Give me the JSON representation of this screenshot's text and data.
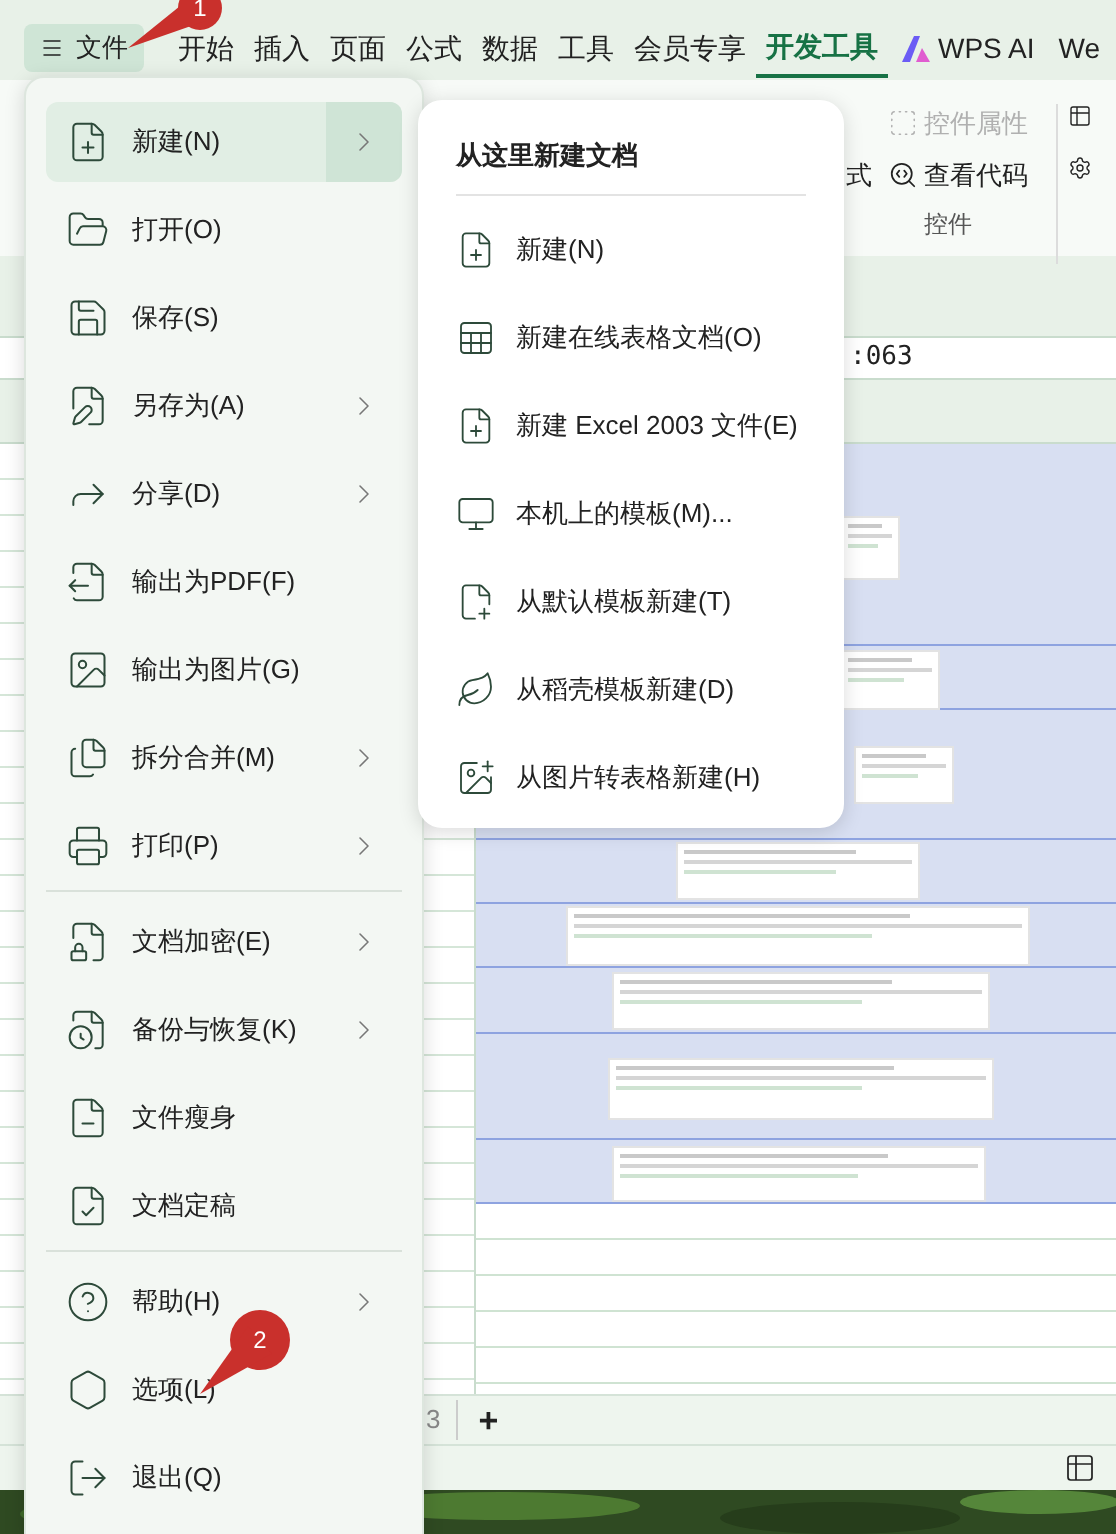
{
  "tabs": [
    {
      "label": "文件",
      "selected": false,
      "kind": "file"
    },
    {
      "label": "开始",
      "selected": false,
      "kind": "plain"
    },
    {
      "label": "插入",
      "selected": false,
      "kind": "plain"
    },
    {
      "label": "页面",
      "selected": false,
      "kind": "plain"
    },
    {
      "label": "公式",
      "selected": false,
      "kind": "plain"
    },
    {
      "label": "数据",
      "selected": false,
      "kind": "plain"
    },
    {
      "label": "工具",
      "selected": false,
      "kind": "plain"
    },
    {
      "label": "会员专享",
      "selected": false,
      "kind": "plain"
    },
    {
      "label": "开发工具",
      "selected": true,
      "kind": "plain"
    },
    {
      "label": "WPS AI",
      "selected": false,
      "kind": "ai"
    },
    {
      "label": "We",
      "selected": false,
      "kind": "plain"
    }
  ],
  "ribbon": {
    "cut_label": "式",
    "buttons": [
      {
        "label": "控件属性",
        "disabled": true
      },
      {
        "label": "查看代码",
        "disabled": false
      }
    ],
    "group_label": "控件"
  },
  "formula_bar": {
    "value": ":063"
  },
  "file_menu": {
    "groups": [
      [
        {
          "label": "新建(N)",
          "has_submenu": true,
          "selected": true
        },
        {
          "label": "打开(O)",
          "has_submenu": false,
          "selected": false
        },
        {
          "label": "保存(S)",
          "has_submenu": false,
          "selected": false
        },
        {
          "label": "另存为(A)",
          "has_submenu": true,
          "selected": false
        },
        {
          "label": "分享(D)",
          "has_submenu": true,
          "selected": false
        },
        {
          "label": "输出为PDF(F)",
          "has_submenu": false,
          "selected": false
        },
        {
          "label": "输出为图片(G)",
          "has_submenu": false,
          "selected": false
        },
        {
          "label": "拆分合并(M)",
          "has_submenu": true,
          "selected": false
        },
        {
          "label": "打印(P)",
          "has_submenu": true,
          "selected": false
        }
      ],
      [
        {
          "label": "文档加密(E)",
          "has_submenu": true,
          "selected": false
        },
        {
          "label": "备份与恢复(K)",
          "has_submenu": true,
          "selected": false
        },
        {
          "label": "文件瘦身",
          "has_submenu": false,
          "selected": false
        },
        {
          "label": "文档定稿",
          "has_submenu": false,
          "selected": false
        }
      ],
      [
        {
          "label": "帮助(H)",
          "has_submenu": true,
          "selected": false
        },
        {
          "label": "选项(L)",
          "has_submenu": false,
          "selected": false
        },
        {
          "label": "退出(Q)",
          "has_submenu": false,
          "selected": false
        }
      ]
    ]
  },
  "submenu": {
    "title": "从这里新建文档",
    "items": [
      {
        "label": "新建(N)"
      },
      {
        "label": "新建在线表格文档(O)"
      },
      {
        "label": "新建 Excel 2003 文件(E)"
      },
      {
        "label": "本机上的模板(M)..."
      },
      {
        "label": "从默认模板新建(T)"
      },
      {
        "label": "从稻壳模板新建(D)"
      },
      {
        "label": "从图片转表格新建(H)"
      }
    ]
  },
  "callouts": [
    {
      "label": "1"
    },
    {
      "label": "2"
    }
  ],
  "sheet_bar": {
    "tab": "3",
    "add": "+"
  }
}
